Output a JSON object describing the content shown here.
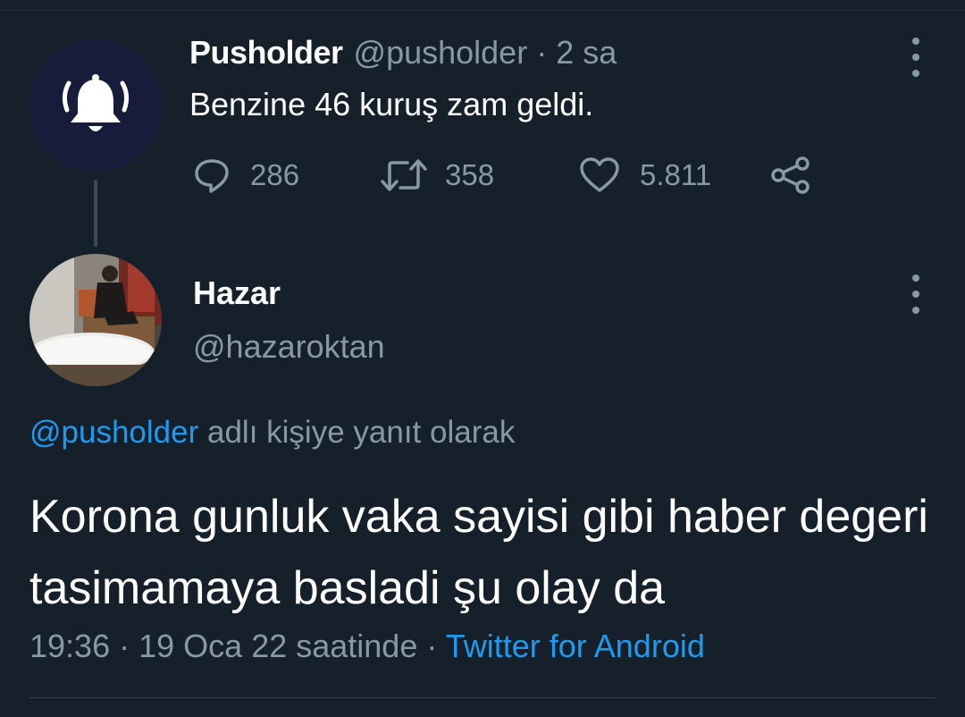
{
  "parent_tweet": {
    "author_name": "Pusholder",
    "author_handle": "@pusholder",
    "separator": "·",
    "time": "2 sa",
    "text": "Benzine 46 kuruş zam geldi.",
    "avatar_icon": "bell-icon",
    "stats": {
      "replies": "286",
      "retweets": "358",
      "likes": "5.811"
    }
  },
  "reply_tweet": {
    "author_name": "Hazar",
    "author_handle": "@hazaroktan",
    "reply_to_mention": "@pusholder",
    "reply_to_suffix": "adlı kişiye yanıt olarak",
    "text": "Korona gunluk vaka sayisi gibi haber degeri tasimamaya basladi şu olay da",
    "time": "19:36",
    "separator": "·",
    "date": "19 Oca 22 saatinde",
    "source": "Twitter for Android"
  },
  "colors": {
    "background": "#15202b",
    "secondary_text": "#8899a6",
    "accent": "#1d9bf0",
    "bell_avatar_bg": "#161c3a"
  }
}
